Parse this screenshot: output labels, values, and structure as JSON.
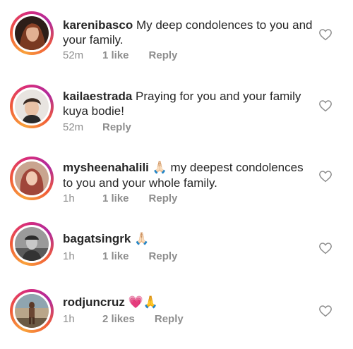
{
  "comments": [
    {
      "username": "karenibasco",
      "line1": "My deep condolences to you and",
      "line2": "your family.",
      "emoji": "",
      "time": "52m",
      "likes": "1 like",
      "reply": "Reply"
    },
    {
      "username": "kailaestrada",
      "line1": "Praying for you and your family",
      "line2": "kuya bodie!",
      "emoji": "",
      "time": "52m",
      "likes": "",
      "reply": "Reply"
    },
    {
      "username": "mysheenahalili",
      "line1": "my deepest condolences",
      "line2": "to you and your whole family.",
      "emoji": "🙏🏻",
      "time": "1h",
      "likes": "1 like",
      "reply": "Reply"
    },
    {
      "username": "bagatsingrk",
      "line1": "",
      "line2": "",
      "emoji": "🙏🏻",
      "time": "1h",
      "likes": "1 like",
      "reply": "Reply"
    },
    {
      "username": "rodjuncruz",
      "line1": "",
      "line2": "",
      "emoji": "💗🙏",
      "time": "1h",
      "likes": "2 likes",
      "reply": "Reply"
    }
  ],
  "icons": {
    "like": "heart-outline-icon"
  },
  "colors": {
    "ring_start": "#f9a13a",
    "ring_end": "#b02a9c",
    "meta": "#8e8e8e"
  }
}
